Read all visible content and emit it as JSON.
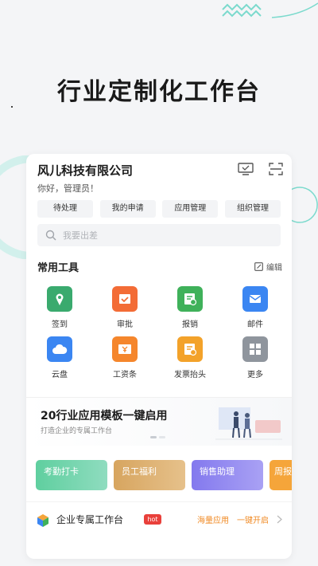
{
  "hero": {
    "title": "行业定制化工作台"
  },
  "colors": {
    "accent_teal": "#7bdacd",
    "tab_bg": "#f3f4f6",
    "hot_red": "#e9403b",
    "link_orange": "#f08a24"
  },
  "card": {
    "company_name": "风儿科技有限公司",
    "greeting": "你好，管理员！",
    "header_icons": [
      "monitor-icon",
      "scan-icon"
    ],
    "tabs": [
      {
        "label": "待处理"
      },
      {
        "label": "我的申请"
      },
      {
        "label": "应用管理"
      },
      {
        "label": "组织管理"
      }
    ],
    "search": {
      "placeholder": "我要出差",
      "icon": "search-icon"
    },
    "tools_section": {
      "title": "常用工具",
      "edit_label": "编辑",
      "items": [
        {
          "label": "签到",
          "icon": "location-pin-icon",
          "color": "#3aaa6e"
        },
        {
          "label": "审批",
          "icon": "approval-icon",
          "color": "#f36c36"
        },
        {
          "label": "报销",
          "icon": "reimburse-icon",
          "color": "#3fb15a"
        },
        {
          "label": "邮件",
          "icon": "mail-icon",
          "color": "#3b86f2"
        },
        {
          "label": "云盘",
          "icon": "cloud-icon",
          "color": "#3b86f2"
        },
        {
          "label": "工资条",
          "icon": "payslip-icon",
          "color": "#f5862c"
        },
        {
          "label": "发票抬头",
          "icon": "invoice-icon",
          "color": "#f3a22a"
        },
        {
          "label": "更多",
          "icon": "grid-icon",
          "color": "#8f959d"
        }
      ]
    },
    "banner": {
      "title": "20行业应用模板一键启用",
      "subtitle": "打造企业的专属工作台"
    },
    "feature_cards": [
      {
        "label": "考勤打卡",
        "color": "#5fcf9f"
      },
      {
        "label": "员工福利",
        "color": "#dcae6a"
      },
      {
        "label": "销售助理",
        "color": "#8d82ef"
      },
      {
        "label": "周报",
        "color": "#f5a53a"
      }
    ],
    "footer": {
      "title": "企业专属工作台",
      "badge": "hot",
      "link_apps": "海量应用",
      "link_enable": "一键开启"
    }
  }
}
